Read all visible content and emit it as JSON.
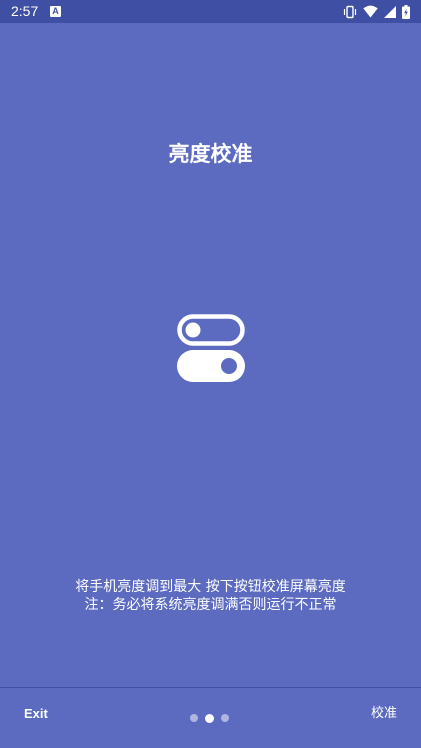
{
  "status_bar": {
    "time": "2:57",
    "app_icon_letter": "A",
    "icons": [
      "vibrate-icon",
      "wifi-icon",
      "signal-icon",
      "battery-charging-icon"
    ]
  },
  "title": "亮度校准",
  "illustration": {
    "icon": "toggle-switches-icon"
  },
  "instructions": {
    "line1": "将手机亮度调到最大 按下按钮校准屏幕亮度",
    "line2": "注：务必将系统亮度调满否则运行不正常"
  },
  "bottom_bar": {
    "exit_label": "Exit",
    "calibrate_label": "校准",
    "pager": {
      "count": 3,
      "active_index": 1
    }
  },
  "colors": {
    "background": "#5c6bc0",
    "status_bar": "#3f4fa3",
    "text": "#ffffff"
  }
}
